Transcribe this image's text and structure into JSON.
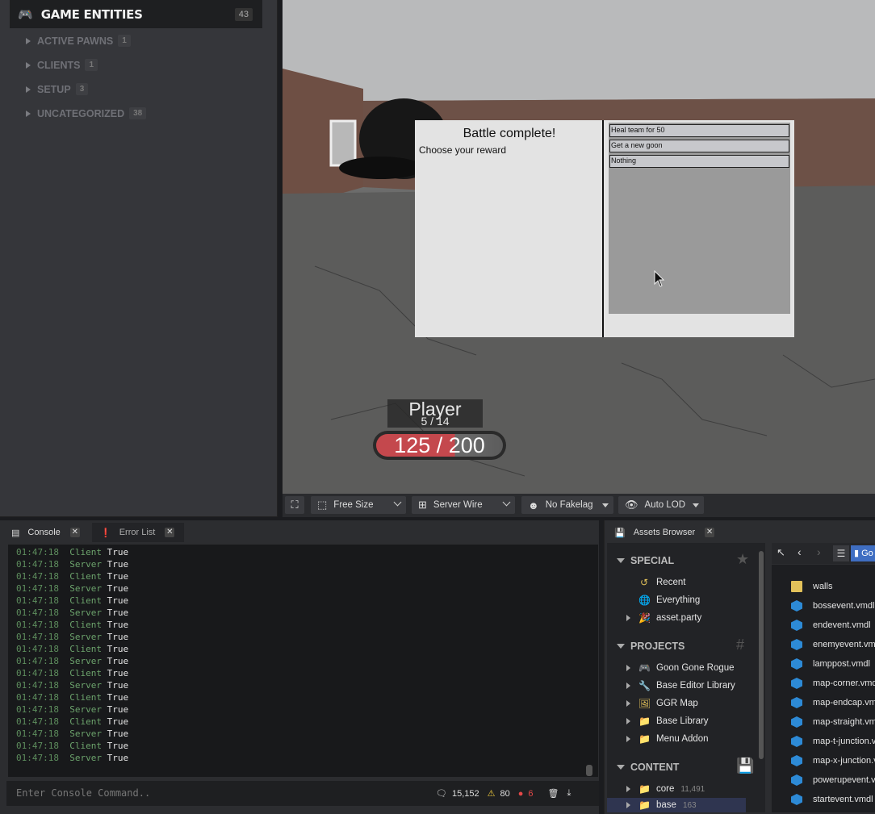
{
  "entities": {
    "title": "GAME ENTITIES",
    "count": "43",
    "categories": [
      {
        "label": "ACTIVE PAWNS",
        "count": "1"
      },
      {
        "label": "CLIENTS",
        "count": "1"
      },
      {
        "label": "SETUP",
        "count": "3"
      },
      {
        "label": "UNCATEGORIZED",
        "count": "38"
      }
    ]
  },
  "dialog": {
    "title": "Battle complete!",
    "subtitle": "Choose your reward",
    "rewards": [
      "Heal team for 50",
      "Get a new goon",
      "Nothing"
    ]
  },
  "hud": {
    "name": "Player",
    "level": "5 / 14",
    "health": "125 / 200"
  },
  "viewport_toolbar": {
    "size": "Free Size",
    "render": "Server Wire",
    "lag": "No Fakelag",
    "lod": "Auto LOD"
  },
  "console": {
    "tab_console": "Console",
    "tab_errors": "Error List",
    "lines": [
      {
        "time": "01:47:18",
        "who": "Client",
        "val": "True"
      },
      {
        "time": "01:47:18",
        "who": "Server",
        "val": "True"
      },
      {
        "time": "01:47:18",
        "who": "Client",
        "val": "True"
      },
      {
        "time": "01:47:18",
        "who": "Server",
        "val": "True"
      },
      {
        "time": "01:47:18",
        "who": "Client",
        "val": "True"
      },
      {
        "time": "01:47:18",
        "who": "Server",
        "val": "True"
      },
      {
        "time": "01:47:18",
        "who": "Client",
        "val": "True"
      },
      {
        "time": "01:47:18",
        "who": "Server",
        "val": "True"
      },
      {
        "time": "01:47:18",
        "who": "Client",
        "val": "True"
      },
      {
        "time": "01:47:18",
        "who": "Server",
        "val": "True"
      },
      {
        "time": "01:47:18",
        "who": "Client",
        "val": "True"
      },
      {
        "time": "01:47:18",
        "who": "Server",
        "val": "True"
      },
      {
        "time": "01:47:18",
        "who": "Client",
        "val": "True"
      },
      {
        "time": "01:47:18",
        "who": "Server",
        "val": "True"
      },
      {
        "time": "01:47:18",
        "who": "Client",
        "val": "True"
      },
      {
        "time": "01:47:18",
        "who": "Server",
        "val": "True"
      },
      {
        "time": "01:47:18",
        "who": "Client",
        "val": "True"
      },
      {
        "time": "01:47:18",
        "who": "Server",
        "val": "True"
      }
    ],
    "placeholder": "Enter Console Command..",
    "messages": "15,152",
    "warnings": "80",
    "errors": "6"
  },
  "assets": {
    "tab": "Assets Browser",
    "special_label": "SPECIAL",
    "special": [
      "Recent",
      "Everything",
      "asset.party"
    ],
    "projects_label": "PROJECTS",
    "projects": [
      "Goon Gone Rogue",
      "Base Editor Library",
      "GGR Map",
      "Base Library",
      "Menu Addon"
    ],
    "content_label": "CONTENT",
    "content": [
      {
        "label": "core",
        "count": "11,491"
      },
      {
        "label": "base",
        "count": "163"
      }
    ],
    "breadcrumb": "Go",
    "files": [
      "walls",
      "bossevent.vmdl",
      "endevent.vmdl",
      "enemyevent.vm",
      "lamppost.vmdl",
      "map-corner.vmd",
      "map-endcap.vm",
      "map-straight.vm",
      "map-t-junction.v",
      "map-x-junction.v",
      "powerupevent.v",
      "startevent.vmdl"
    ]
  },
  "colors": {
    "health": "#c4484d",
    "console_time": "#5d8d5d",
    "folder": "#e3c25a",
    "model": "#2d8ad6"
  }
}
